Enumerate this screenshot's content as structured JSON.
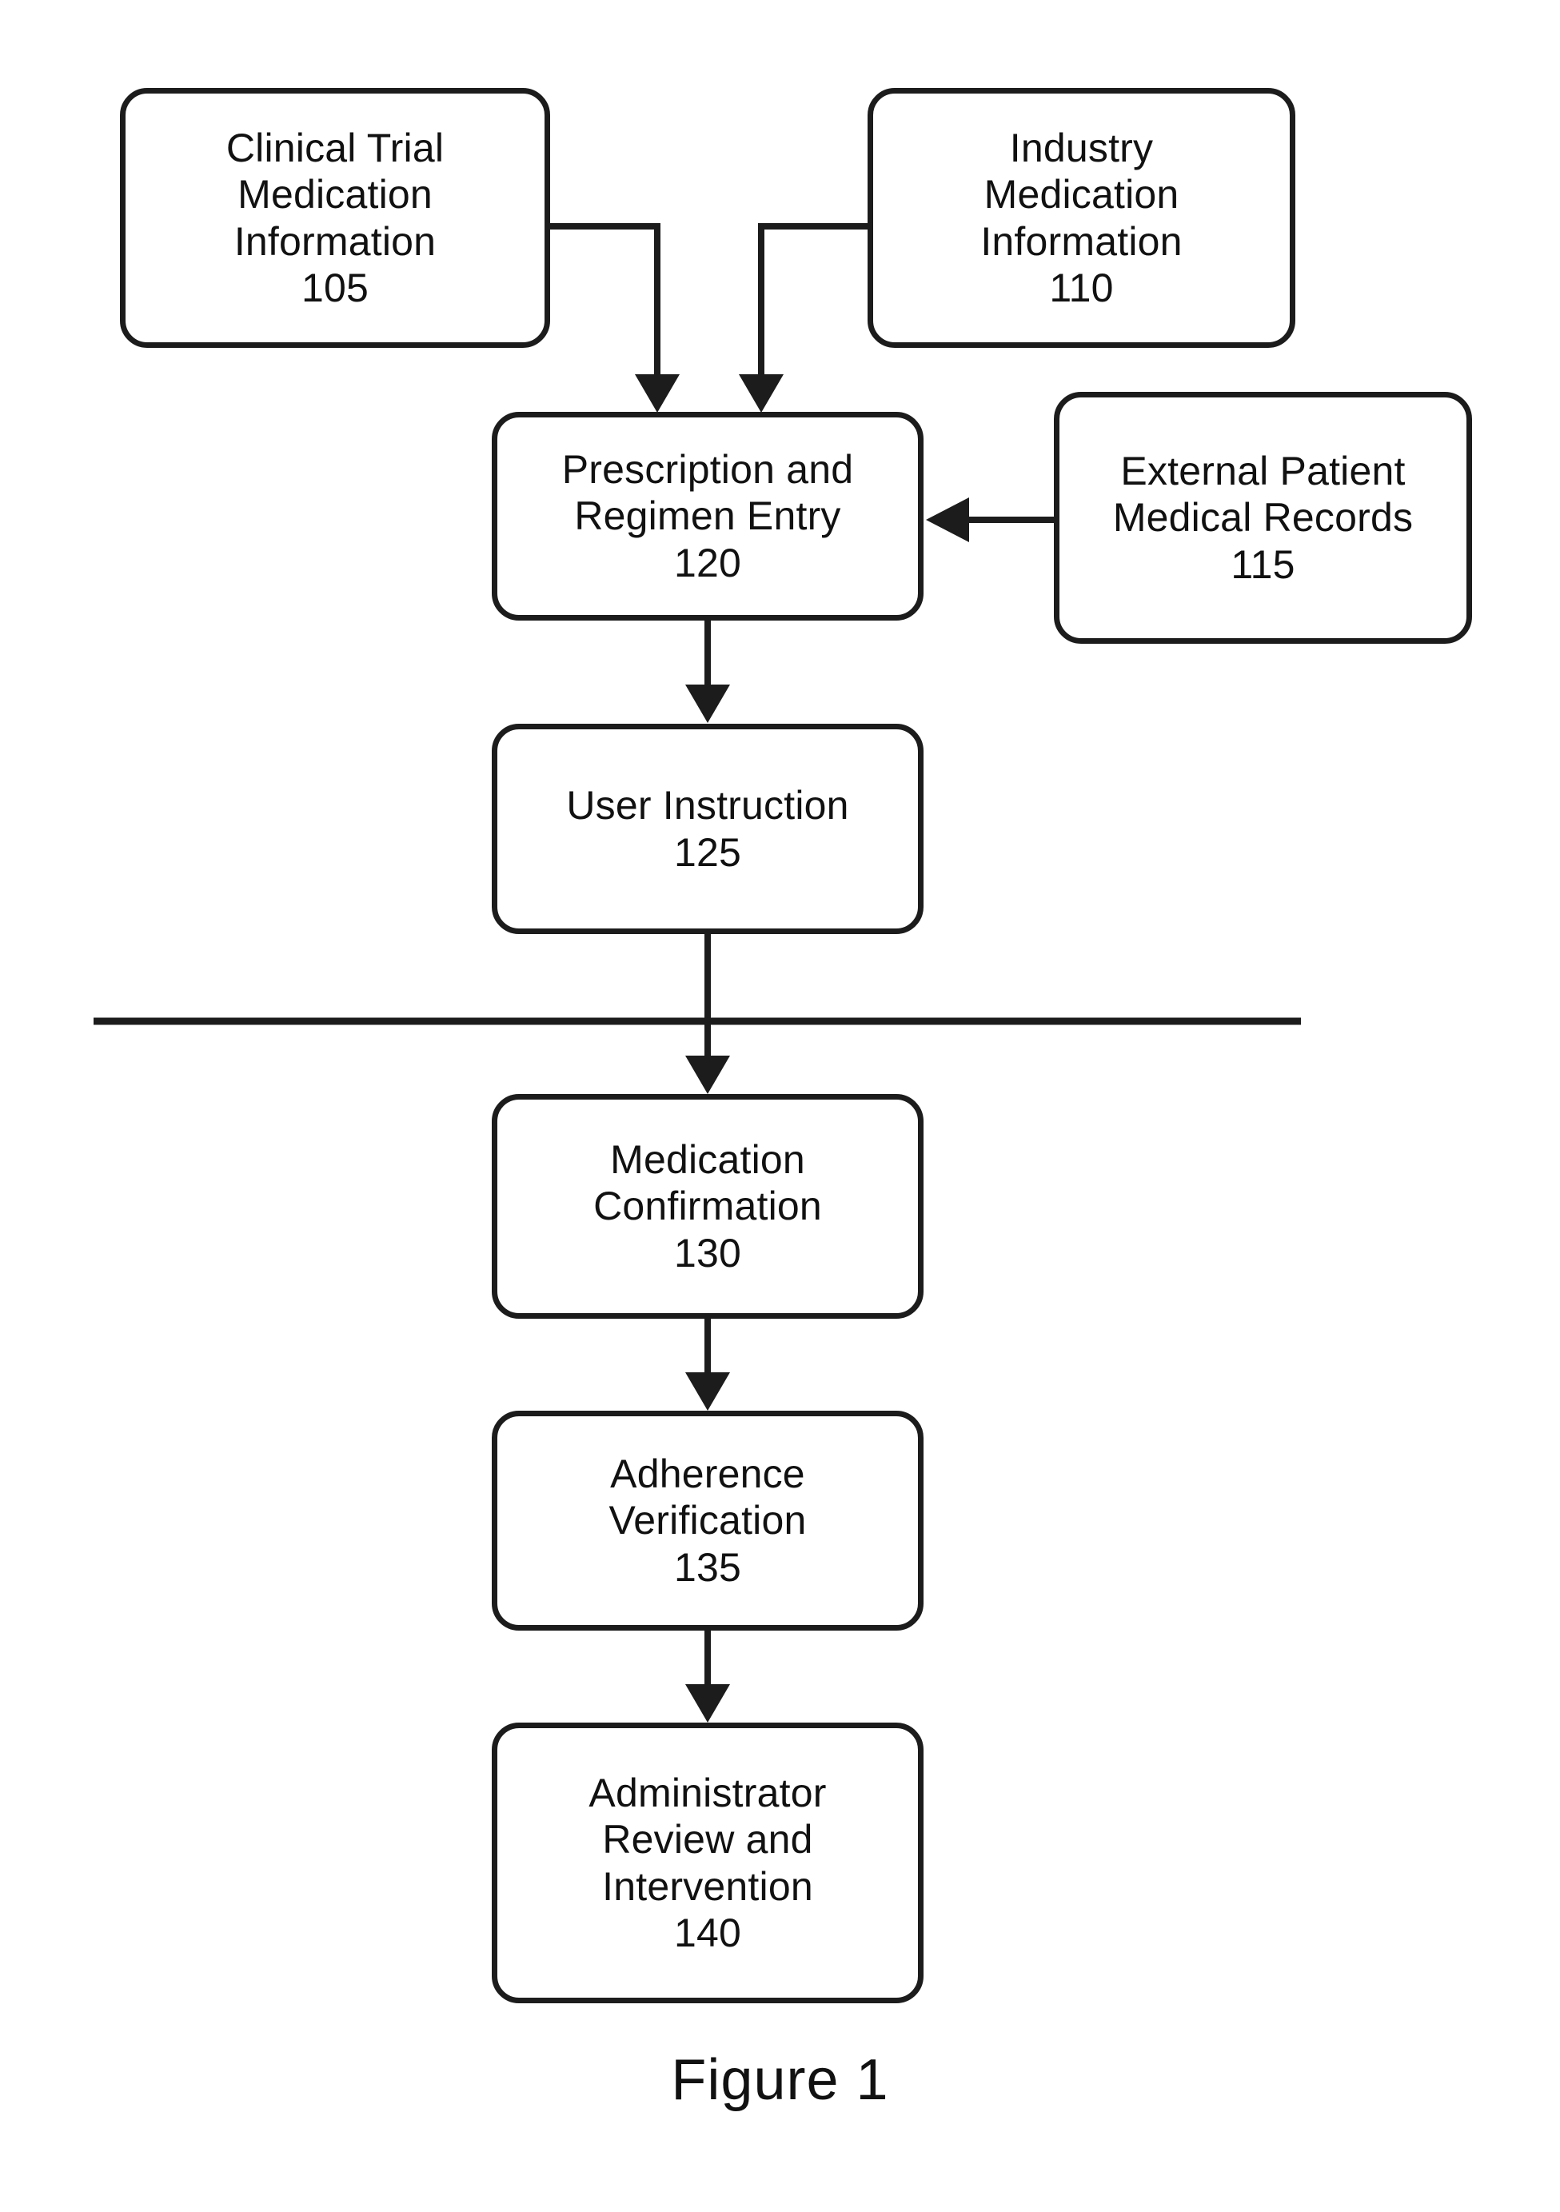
{
  "figure": {
    "caption": "Figure 1",
    "divider_label": "horizontal-section-divider"
  },
  "nodes": {
    "clinical_trial": {
      "ref": "105",
      "lines": [
        "Clinical Trial",
        "Medication",
        "Information"
      ],
      "line1": "Clinical Trial",
      "line2": "Medication",
      "line3": "Information"
    },
    "industry": {
      "ref": "110",
      "lines": [
        "Industry",
        "Medication",
        "Information"
      ],
      "line1": "Industry",
      "line2": "Medication",
      "line3": "Information"
    },
    "external_records": {
      "ref": "115",
      "lines": [
        "External Patient",
        "Medical Records"
      ],
      "line1": "External Patient",
      "line2": "Medical Records"
    },
    "prescription_entry": {
      "ref": "120",
      "lines": [
        "Prescription and",
        "Regimen Entry"
      ],
      "line1": "Prescription and",
      "line2": "Regimen Entry"
    },
    "user_instruction": {
      "ref": "125",
      "lines": [
        "User Instruction"
      ],
      "line1": "User Instruction"
    },
    "medication_confirmation": {
      "ref": "130",
      "lines": [
        "Medication",
        "Confirmation"
      ],
      "line1": "Medication",
      "line2": "Confirmation"
    },
    "adherence_verification": {
      "ref": "135",
      "lines": [
        "Adherence",
        "Verification"
      ],
      "line1": "Adherence",
      "line2": "Verification"
    },
    "administrator_review": {
      "ref": "140",
      "lines": [
        "Administrator",
        "Review and",
        "Intervention"
      ],
      "line1": "Administrator",
      "line2": "Review and",
      "line3": "Intervention"
    }
  },
  "connectors": [
    {
      "id": "c105-120",
      "from": "105",
      "to": "120",
      "style": "elbow-down-arrow"
    },
    {
      "id": "c110-120",
      "from": "110",
      "to": "120",
      "style": "elbow-down-arrow"
    },
    {
      "id": "c115-120",
      "from": "115",
      "to": "120",
      "style": "straight-left-arrow"
    },
    {
      "id": "c120-125",
      "from": "120",
      "to": "125",
      "style": "straight-down-arrow"
    },
    {
      "id": "c125-130",
      "from": "125",
      "to": "130",
      "style": "straight-down-arrow"
    },
    {
      "id": "c130-135",
      "from": "130",
      "to": "135",
      "style": "straight-down-arrow"
    },
    {
      "id": "c135-140",
      "from": "135",
      "to": "140",
      "style": "straight-down-arrow"
    }
  ],
  "colors": {
    "stroke": "#1c1c1c",
    "text": "#111111",
    "background": "#ffffff"
  }
}
